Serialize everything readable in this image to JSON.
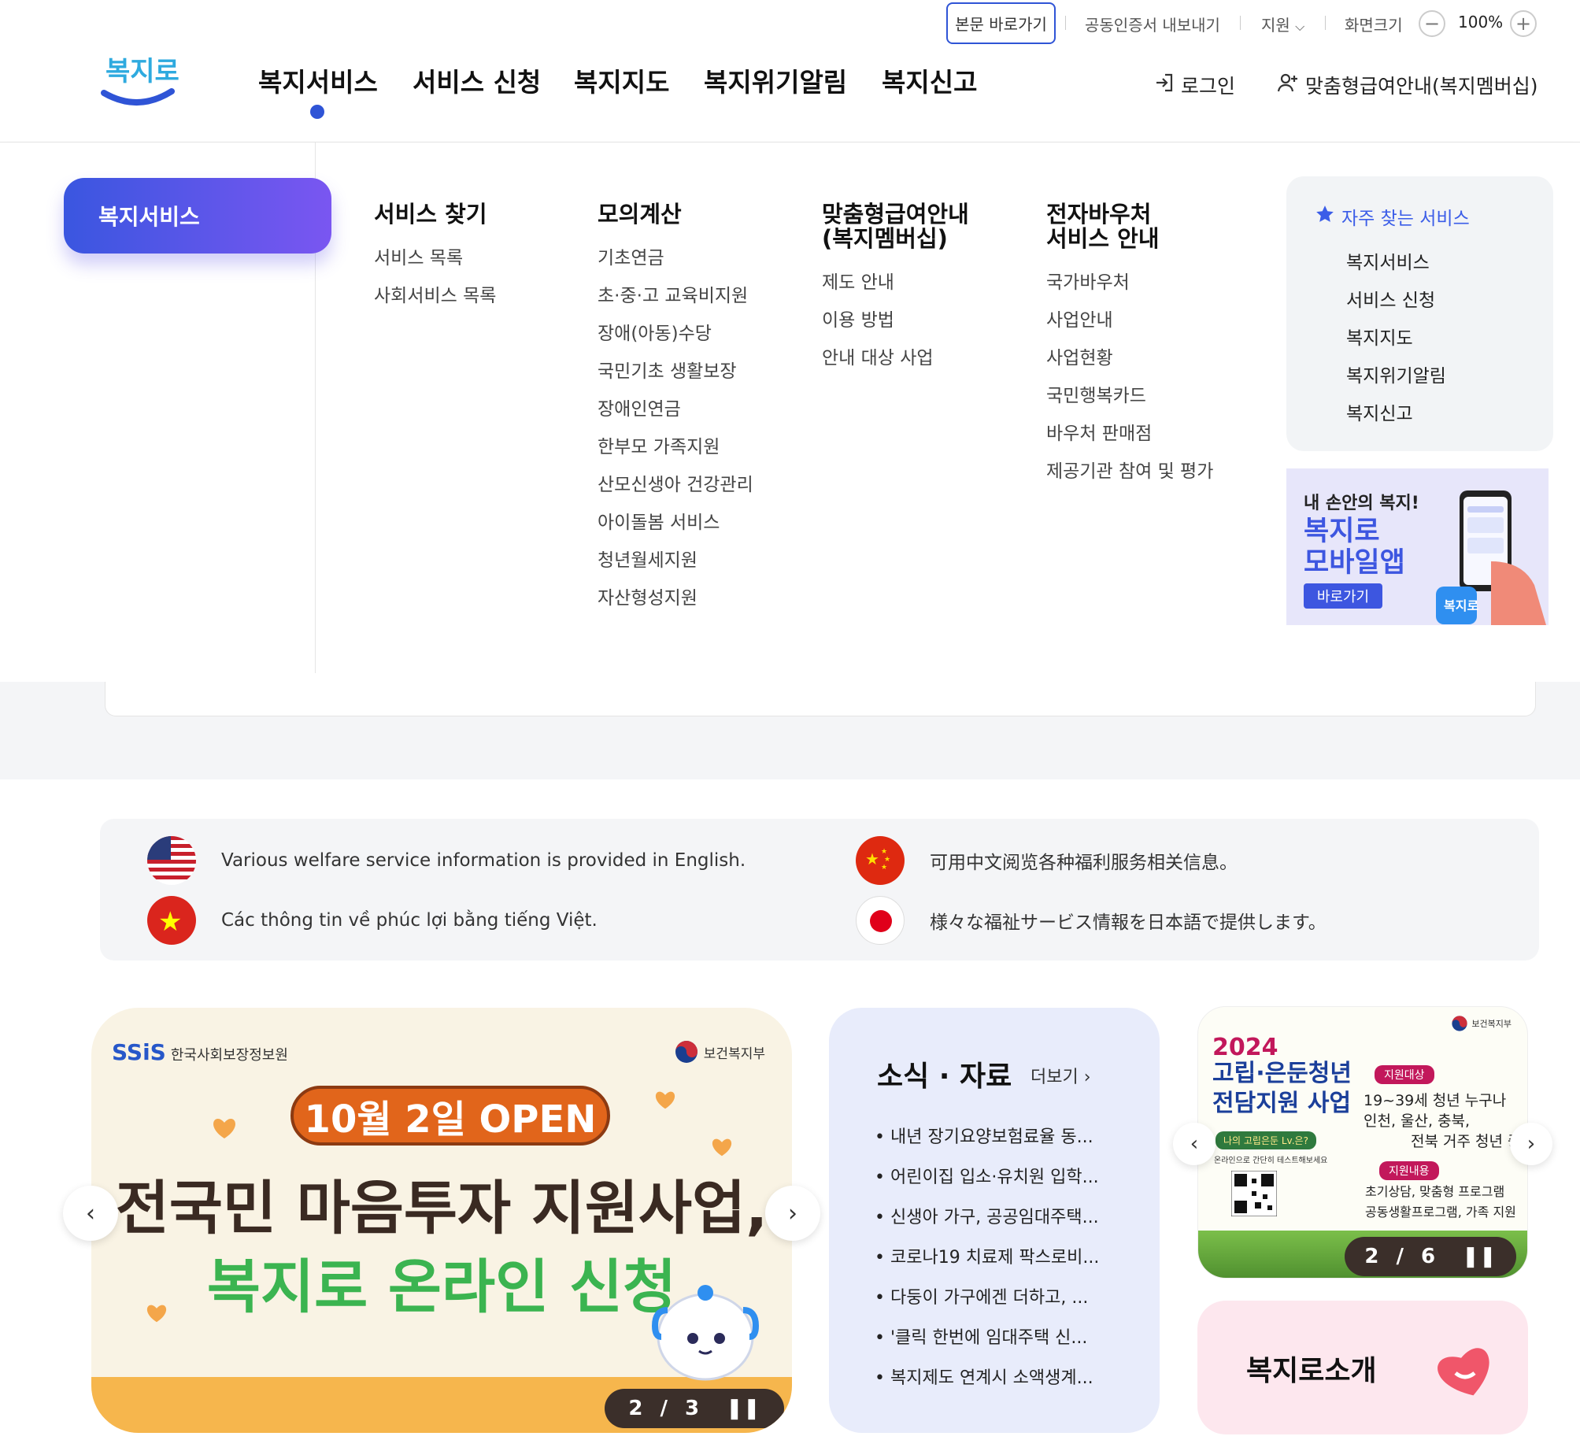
{
  "utility": {
    "skip_link": "본문 바로가기",
    "cert_export": "공동인증서 내보내기",
    "support": "지원",
    "screen_size_label": "화면크기",
    "zoom_minus": "−",
    "zoom_value": "100%",
    "zoom_plus": "+"
  },
  "header": {
    "logo_text": "복지로",
    "nav": [
      "복지서비스",
      "서비스 신청",
      "복지지도",
      "복지위기알림",
      "복지신고"
    ],
    "active_nav_index": 0,
    "login": "로그인",
    "membership": "맞춤형급여안내(복지멤버십)"
  },
  "mega_menu": {
    "section_title": "복지서비스",
    "columns": [
      {
        "title": "서비스 찾기",
        "links": [
          "서비스 목록",
          "사회서비스 목록"
        ]
      },
      {
        "title": "모의계산",
        "links": [
          "기초연금",
          "초·중·고 교육비지원",
          "장애(아동)수당",
          "국민기초 생활보장",
          "장애인연금",
          "한부모 가족지원",
          "산모신생아 건강관리",
          "아이돌봄 서비스",
          "청년월세지원",
          "자산형성지원"
        ]
      },
      {
        "title_line1": "맞춤형급여안내",
        "title_line2": "(복지멤버십)",
        "links": [
          "제도 안내",
          "이용 방법",
          "안내 대상 사업"
        ]
      },
      {
        "title_line1": "전자바우처",
        "title_line2": "서비스 안내",
        "links": [
          "국가바우처",
          "사업안내",
          "사업현황",
          "국민행복카드",
          "바우처 판매점",
          "제공기관 참여 및 평가"
        ]
      }
    ],
    "favorites": {
      "title": "자주 찾는 서비스",
      "links": [
        "복지서비스",
        "서비스 신청",
        "복지지도",
        "복지위기알림",
        "복지신고"
      ]
    },
    "app_banner": {
      "line1": "내 손안의 복지!",
      "line2": "복지로",
      "line3": "모바일앱",
      "button": "바로가기"
    }
  },
  "languages": [
    {
      "flag": "us-flag",
      "text": "Various welfare service information is provided in English."
    },
    {
      "flag": "china-flag",
      "text": "可用中文阅览各种福利服务相关信息。"
    },
    {
      "flag": "vietnam-flag",
      "text": "Các thông tin về phúc lợi bằng tiếng Việt."
    },
    {
      "flag": "japan-flag",
      "text": "様々な福祉サービス情報を日本語で提供します。"
    }
  ],
  "main_banner": {
    "org_logo": "SSiS",
    "org_name": "한국사회보장정보원",
    "ministry": "보건복지부",
    "badge": "10월 2일 OPEN",
    "title1": "전국민 마음투자 지원사업,",
    "title2": "복지로 온라인 신청",
    "pager_current": "2",
    "pager_sep": "/",
    "pager_total": "3",
    "pause": "❚❚"
  },
  "news": {
    "title": "소식 · 자료",
    "more": "더보기",
    "items": [
      "내년 장기요양보험료율 동...",
      "어린이집 입소·유치원 입학...",
      "신생아 가구, 공공임대주택...",
      "코로나19 치료제 팍스로비...",
      "다둥이 가구에겐 더하고, ...",
      "'클릭 한번에 임대주택 신...",
      "복지제도 연계시 소액생계..."
    ]
  },
  "side_banner": {
    "ministry": "보건복지부",
    "year": "2024",
    "title1": "고립·은둔청년",
    "title2": "전담지원 사업",
    "tag1": "지원대상",
    "text1": "19~39세 청년 누구나",
    "text2": "인천, 울산, 충북,",
    "text3": "전북 거주 청년 중",
    "tag2": "지원내용",
    "text4": "초기상담, 맞춤형 프로그램",
    "text5": "공동생활프로그램, 가족 지원",
    "green_tag": "나의 고립은둔 Lv.은?",
    "green_sub": "온라인으로 간단히 테스트해보세요",
    "pager_current": "2",
    "pager_sep": "/",
    "pager_total": "6",
    "pause": "❚❚"
  },
  "intro": {
    "title": "복지로소개"
  },
  "colors": {
    "accent": "#2f54d6",
    "pill_start": "#3a56e0",
    "pill_end": "#7a56f1"
  }
}
